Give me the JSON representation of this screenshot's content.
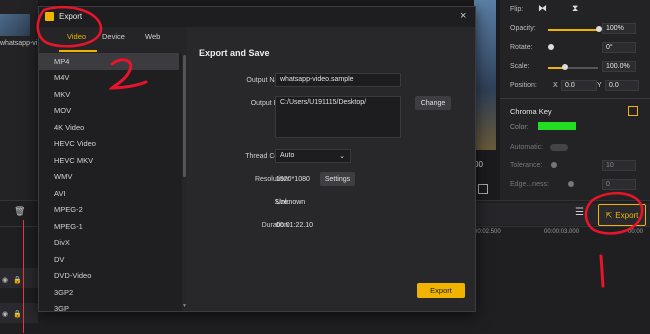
{
  "dialog": {
    "title": "Export",
    "tabs": [
      "Video",
      "Device",
      "Web"
    ],
    "formats": [
      "MP4",
      "M4V",
      "MKV",
      "MOV",
      "4K Video",
      "HEVC Video",
      "HEVC MKV",
      "WMV",
      "AVI",
      "MPEG-2",
      "MPEG-1",
      "DivX",
      "DV",
      "DVD-Video",
      "3GP2",
      "3GP"
    ],
    "section_title": "Export and Save",
    "output_name_label": "Output Name:",
    "output_name": "whatsapp-video.sample",
    "output_path_label": "Output Path:",
    "output_path": "C:/Users/U191115/Desktop/",
    "change_label": "Change",
    "thread_label": "Thread Count:",
    "thread_value": "Auto",
    "resolution_label": "Resolution:",
    "resolution": "1920*1080",
    "settings_label": "Settings",
    "size_label": "Size:",
    "size": "Unknown",
    "duration_label": "Duration:",
    "duration": "00:01:22.10",
    "export_label": "Export"
  },
  "background": {
    "media_label": "whatsapp-vi...",
    "preview_time": "00",
    "flip_label": "Flip:",
    "opacity_label": "Opacity:",
    "opacity_value": "100%",
    "rotate_label": "Rotate:",
    "rotate_value": "0°",
    "scale_label": "Scale:",
    "scale_value": "100.0%",
    "position_label": "Position:",
    "pos_x_label": "X",
    "pos_x": "0.0",
    "pos_y_label": "Y",
    "pos_y": "0.0",
    "chroma_label": "Chroma Key",
    "color_label": "Color:",
    "automatic_label": "Automatic:",
    "tolerance_label": "Tolerance:",
    "tolerance_value": "10",
    "edge_label": "Edge...ness:",
    "edge_value": "0",
    "export_label": "Export",
    "ruler_a": "00:02.500",
    "ruler_b": "00:00:03.000",
    "ruler_c": "00:00"
  },
  "annotations": {
    "num1": "1",
    "num2": "2"
  },
  "colors": {
    "accent": "#f0b400",
    "chroma": "#22dd22",
    "annotation": "#e8142a"
  }
}
